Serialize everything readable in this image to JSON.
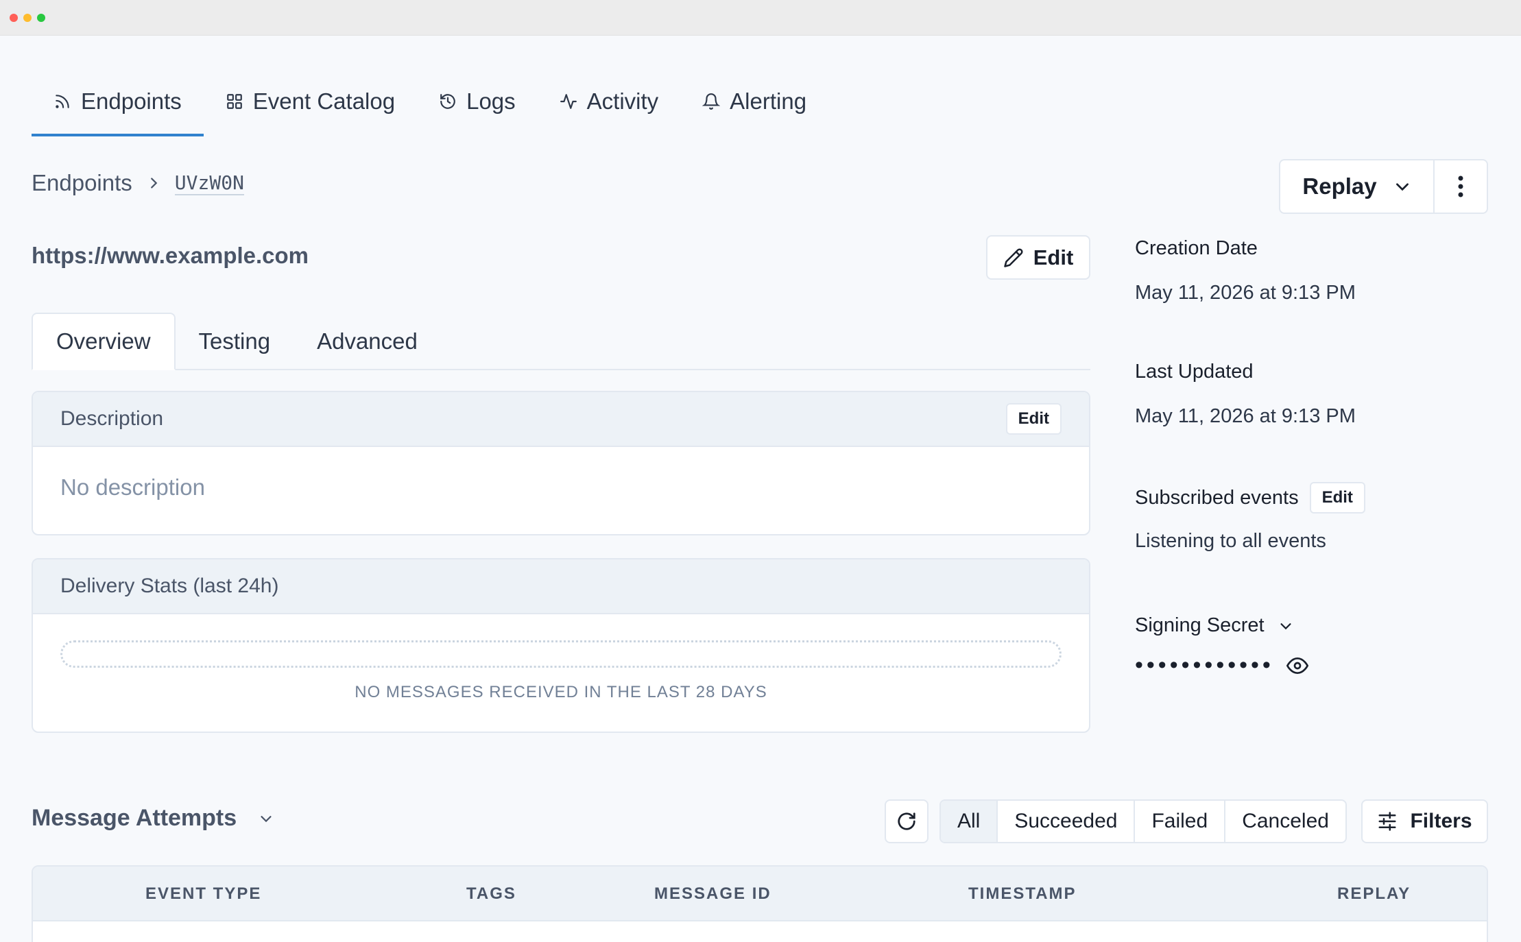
{
  "nav": {
    "items": [
      {
        "label": "Endpoints",
        "icon": "rss-icon",
        "active": true
      },
      {
        "label": "Event Catalog",
        "icon": "grid-icon",
        "active": false
      },
      {
        "label": "Logs",
        "icon": "history-icon",
        "active": false
      },
      {
        "label": "Activity",
        "icon": "activity-icon",
        "active": false
      },
      {
        "label": "Alerting",
        "icon": "bell-icon",
        "active": false
      }
    ]
  },
  "breadcrumb": {
    "parent": "Endpoints",
    "current": "UVzW0N"
  },
  "replay": {
    "label": "Replay"
  },
  "endpoint": {
    "url": "https://www.example.com",
    "edit_label": "Edit"
  },
  "tabs": [
    "Overview",
    "Testing",
    "Advanced"
  ],
  "description": {
    "title": "Description",
    "edit_label": "Edit",
    "empty_text": "No description"
  },
  "delivery_stats": {
    "title": "Delivery Stats (last 24h)",
    "empty_text": "NO MESSAGES RECEIVED IN THE LAST 28 DAYS"
  },
  "side": {
    "creation_label": "Creation Date",
    "creation_value": "May 11, 2026 at 9:13 PM",
    "updated_label": "Last Updated",
    "updated_value": "May 11, 2026 at 9:13 PM",
    "subscribed_label": "Subscribed events",
    "subscribed_edit": "Edit",
    "subscribed_value": "Listening to all events",
    "secret_label": "Signing Secret",
    "secret_masked": "••••••••••••"
  },
  "message_attempts": {
    "title": "Message Attempts",
    "filters": [
      "All",
      "Succeeded",
      "Failed",
      "Canceled"
    ],
    "active_filter": "All",
    "filters_label": "Filters",
    "columns": [
      "EVENT TYPE",
      "TAGS",
      "MESSAGE ID",
      "TIMESTAMP",
      "REPLAY"
    ]
  },
  "colors": {
    "accent": "#3182ce",
    "background": "#f7f9fc",
    "border": "#e2e8f0"
  }
}
